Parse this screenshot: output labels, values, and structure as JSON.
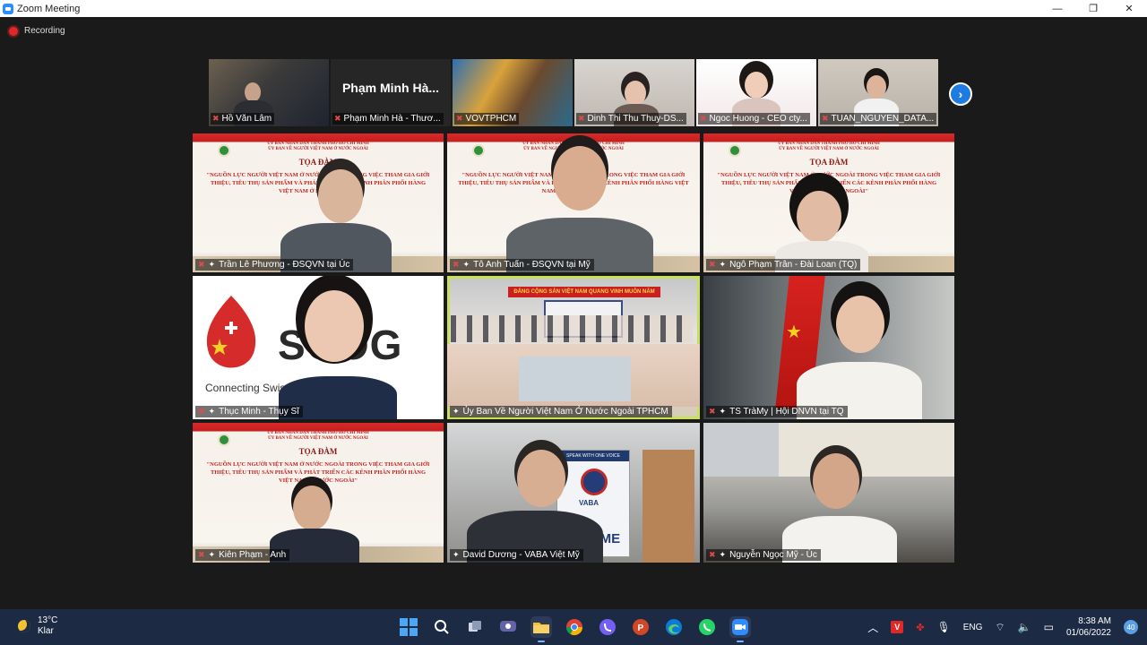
{
  "window": {
    "title": "Zoom Meeting",
    "minimize": "—",
    "maximize": "❐",
    "close": "✕"
  },
  "recording": {
    "label": "Recording"
  },
  "filmstrip": [
    {
      "name": "Hồ Văn Lâm"
    },
    {
      "name": "Phạm Minh Hà - Thươ...",
      "big_name": "Phạm Minh Hà..."
    },
    {
      "name": "VOVTPHCM"
    },
    {
      "name": "Dinh Thi Thu Thuy-DS..."
    },
    {
      "name": "Ngoc Huong - CEO cty..."
    },
    {
      "name": "TUAN_NGUYEN_DATA..."
    }
  ],
  "banner": {
    "org_line1": "ỦY BAN NHÂN DÂN THÀNH PHỐ HỒ CHÍ MINH",
    "org_line2": "ỦY BAN VỀ NGƯỜI VIỆT NAM Ở NƯỚC NGOÀI",
    "title": "TỌA ĐÀM",
    "topic": "\"NGUỒN LỰC NGƯỜI VIỆT NAM Ở NƯỚC NGOÀI TRONG VIỆC THAM GIA GIỚI THIỆU, TIÊU THỤ SẢN PHẨM VÀ PHÁT TRIỂN CÁC KÊNH PHÂN PHỐI HÀNG VIỆT NAM Ở NƯỚC NGOÀI\""
  },
  "tiles": [
    {
      "name": "Trần Lê Phương - ĐSQVN tại Úc"
    },
    {
      "name": "Tô Anh Tuấn - ĐSQVN tại Mỹ"
    },
    {
      "name": "Ngô Phạm Trân - Đài Loan (TQ)"
    },
    {
      "name": "Thục Minh - Thụy Sĩ",
      "logo_text": "SCOG",
      "logo_sub": "Connecting Swiss ... Business"
    },
    {
      "name": "Ủy Ban Về Người Việt Nam Ở Nước Ngoài TPHCM",
      "room_banner": "ĐẢNG CỘNG SẢN VIỆT NAM QUANG VINH MUÔN NĂM"
    },
    {
      "name": "TS TràMy | Hội DNVN tại TQ"
    },
    {
      "name": "Kiên Phạm - Anh"
    },
    {
      "name": "David Dương - VABA Việt Mỹ",
      "sign_top": "SPEAK WITH ONE VOICE",
      "sign_logo": "VABA",
      "sign_bottom": "OME"
    },
    {
      "name": "Nguyễn Ngọc Mỹ - Úc"
    }
  ],
  "taskbar": {
    "weather_temp": "13°C",
    "weather_desc": "Klar",
    "lang": "ENG",
    "time": "8:38 AM",
    "date": "01/06/2022",
    "notifications": "40"
  },
  "colors": {
    "accent": "#2d8cff",
    "active_speaker": "#c8e05a",
    "mic_off": "#e24a4a",
    "taskbar": "#1d2a44"
  }
}
